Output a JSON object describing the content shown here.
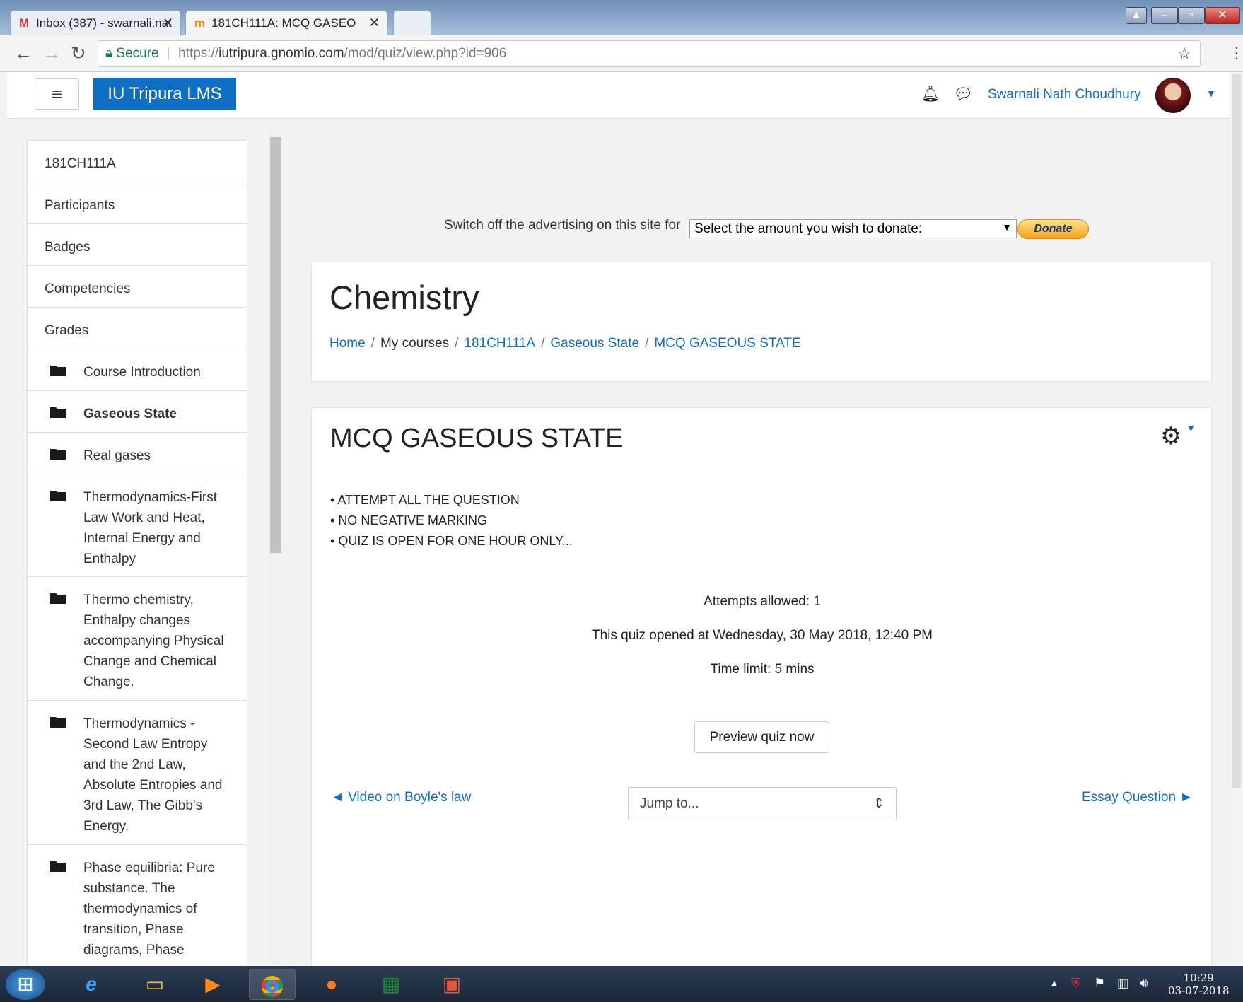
{
  "browser": {
    "tabs": [
      {
        "title": "Inbox (387) - swarnali.nat",
        "icon": "gmail-icon"
      },
      {
        "title": "181CH111A: MCQ GASEO",
        "icon": "moodle-icon"
      }
    ],
    "url_secure_label": "Secure",
    "url_scheme": "https://",
    "url_host": "iutripura.gnomio.com",
    "url_path": "/mod/quiz/view.php?id=906"
  },
  "navbar": {
    "menu_icon": "≡",
    "brand": "IU Tripura LMS",
    "user_name": "Swarnali Nath Choudhury"
  },
  "sidebar": {
    "items": [
      {
        "label": "181CH111A",
        "section": false
      },
      {
        "label": "Participants",
        "section": false
      },
      {
        "label": "Badges",
        "section": false
      },
      {
        "label": "Competencies",
        "section": false
      },
      {
        "label": "Grades",
        "section": false
      },
      {
        "label": "Course Introduction",
        "section": true
      },
      {
        "label": "Gaseous State",
        "section": true,
        "active": true
      },
      {
        "label": "Real gases",
        "section": true
      },
      {
        "label": "Thermodynamics-First Law Work and Heat, Internal Energy and Enthalpy",
        "section": true
      },
      {
        "label": "Thermo chemistry, Enthalpy changes accompanying Physical Change and Chemical Change.",
        "section": true
      },
      {
        "label": "Thermodynamics - Second Law Entropy and the 2nd Law, Absolute Entropies and 3rd Law, The Gibb's Energy.",
        "section": true
      },
      {
        "label": "Phase equilibria: Pure substance. The thermodynamics of transition, Phase diagrams, Phase",
        "section": true
      }
    ]
  },
  "donate": {
    "text": "Switch off the advertising on this site for",
    "select_value": "Select the amount you wish to donate:",
    "button": "Donate"
  },
  "header": {
    "course_title": "Chemistry",
    "breadcrumb": [
      "Home",
      "My courses",
      "181CH111A",
      "Gaseous State",
      "MCQ GASEOUS STATE"
    ],
    "breadcrumb_sep": "/"
  },
  "quiz": {
    "title": "MCQ GASEOUS STATE",
    "intro": [
      "ATTEMPT ALL THE QUESTION",
      "NO NEGATIVE MARKING",
      "QUIZ IS OPEN FOR ONE HOUR ONLY..."
    ],
    "attempts": "Attempts allowed: 1",
    "opened": "This quiz opened at Wednesday, 30 May 2018, 12:40 PM",
    "time_limit": "Time limit: 5 mins",
    "preview_button": "Preview quiz now",
    "prev_link": "◄ Video on Boyle's law",
    "next_link": "Essay Question ►",
    "jump_placeholder": "Jump to..."
  },
  "taskbar": {
    "time": "10:29",
    "date": "03-07-2018"
  },
  "colors": {
    "link": "#0f6fc5",
    "brand": "#0f6fc5"
  }
}
